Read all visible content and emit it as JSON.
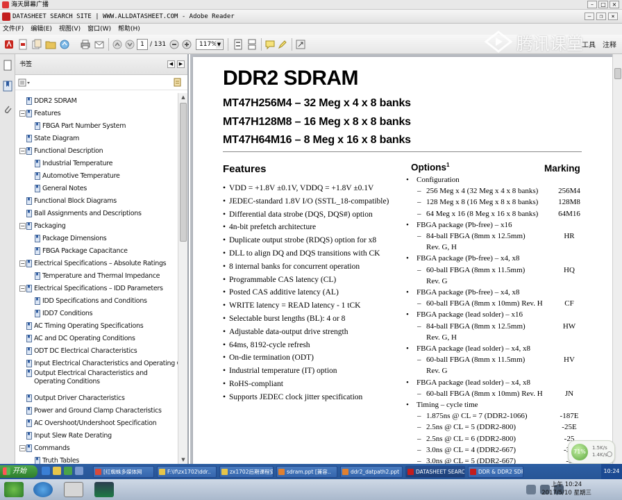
{
  "window": {
    "outer_title": "海天屏幕广播",
    "app_title": "DATASHEET SEARCH SITE | WWW.ALLDATASHEET.COM - Adobe Reader"
  },
  "menu": [
    "文件(F)",
    "编辑(E)",
    "视图(V)",
    "窗口(W)",
    "帮助(H)"
  ],
  "toolbar": {
    "page_current": "1",
    "page_total": "/ 131",
    "zoom": "117%",
    "right_buttons": [
      "工具",
      "注释"
    ],
    "watermark_text": "腾讯课堂"
  },
  "bookmarks": {
    "title": "书签",
    "items": [
      {
        "label": "DDR2 SDRAM",
        "level": 0,
        "expandable": false
      },
      {
        "label": "Features",
        "level": 0,
        "expandable": true
      },
      {
        "label": "FBGA Part Number System",
        "level": 1,
        "expandable": false
      },
      {
        "label": "State Diagram",
        "level": 0,
        "expandable": false
      },
      {
        "label": "Functional Description",
        "level": 0,
        "expandable": true
      },
      {
        "label": "Industrial Temperature",
        "level": 1,
        "expandable": false
      },
      {
        "label": "Automotive Temperature",
        "level": 1,
        "expandable": false
      },
      {
        "label": "General Notes",
        "level": 1,
        "expandable": false
      },
      {
        "label": "Functional Block Diagrams",
        "level": 0,
        "expandable": false
      },
      {
        "label": "Ball Assignments and Descriptions",
        "level": 0,
        "expandable": false
      },
      {
        "label": "Packaging",
        "level": 0,
        "expandable": true
      },
      {
        "label": "Package Dimensions",
        "level": 1,
        "expandable": false
      },
      {
        "label": "FBGA Package Capacitance",
        "level": 1,
        "expandable": false
      },
      {
        "label": "Electrical Specifications – Absolute Ratings",
        "level": 0,
        "expandable": true
      },
      {
        "label": "Temperature and Thermal Impedance",
        "level": 1,
        "expandable": false
      },
      {
        "label": "Electrical Specifications – IDD Parameters",
        "level": 0,
        "expandable": true
      },
      {
        "label": "IDD Specifications and Conditions",
        "level": 1,
        "expandable": false
      },
      {
        "label": "IDD7 Conditions",
        "level": 1,
        "expandable": false
      },
      {
        "label": "AC Timing Operating Specifications",
        "level": 0,
        "expandable": false
      },
      {
        "label": "AC and DC Operating Conditions",
        "level": 0,
        "expandable": false
      },
      {
        "label": "ODT DC Electrical Characteristics",
        "level": 0,
        "expandable": false
      },
      {
        "label": "Input Electrical Characteristics and Operating Conditions",
        "level": 0,
        "expandable": false
      },
      {
        "label": "Output Electrical Characteristics and Operating Conditions",
        "level": 0,
        "expandable": false
      },
      {
        "label": "Output Driver Characteristics",
        "level": 0,
        "expandable": false
      },
      {
        "label": "Power and Ground Clamp Characteristics",
        "level": 0,
        "expandable": false
      },
      {
        "label": "AC Overshoot/Undershoot Specification",
        "level": 0,
        "expandable": false
      },
      {
        "label": "Input Slew Rate Derating",
        "level": 0,
        "expandable": false
      },
      {
        "label": "Commands",
        "level": 0,
        "expandable": true
      },
      {
        "label": "Truth Tables",
        "level": 1,
        "expandable": false
      }
    ]
  },
  "document": {
    "title": "DDR2 SDRAM",
    "parts": [
      "MT47H256M4 – 32 Meg x 4 x 8 banks",
      "MT47H128M8 – 16 Meg x 8 x 8 banks",
      "MT47H64M16 – 8 Meg x 16 x 8 banks"
    ],
    "features_heading": "Features",
    "features": [
      "VDD = +1.8V ±0.1V, VDDQ = +1.8V ±0.1V",
      "JEDEC-standard 1.8V I/O (SSTL_18-compatible)",
      "Differential data strobe (DQS, DQS#) option",
      "4n-bit prefetch architecture",
      "Duplicate output strobe (RDQS) option for x8",
      "DLL to align DQ and DQS transitions with CK",
      "8 internal banks for concurrent operation",
      "Programmable CAS latency (CL)",
      "Posted CAS additive latency (AL)",
      "WRITE latency = READ latency - 1 tCK",
      "Selectable burst lengths (BL): 4 or 8",
      "Adjustable data-output drive strength",
      "64ms, 8192-cycle refresh",
      "On-die termination (ODT)",
      "Industrial temperature (IT) option",
      "RoHS-compliant",
      "Supports JEDEC clock jitter specification"
    ],
    "options_heading": "Options",
    "options_sup": "1",
    "marking_heading": "Marking",
    "options": [
      {
        "text": "Configuration",
        "level": 1,
        "mark": ""
      },
      {
        "text": "256 Meg x 4 (32 Meg x 4 x 8 banks)",
        "level": 2,
        "mark": "256M4"
      },
      {
        "text": "128 Meg x 8 (16 Meg x 8 x 8 banks)",
        "level": 2,
        "mark": "128M8"
      },
      {
        "text": "64 Meg x 16 (8 Meg x 16 x 8 banks)",
        "level": 2,
        "mark": "64M16"
      },
      {
        "text": "FBGA package (Pb-free) – x16",
        "level": 1,
        "mark": ""
      },
      {
        "text": "84-ball FBGA (8mm x 12.5mm)",
        "level": 2,
        "mark": "HR"
      },
      {
        "text": "Rev. G, H",
        "level": 3,
        "mark": ""
      },
      {
        "text": "FBGA package (Pb-free) – x4, x8",
        "level": 1,
        "mark": ""
      },
      {
        "text": "60-ball FBGA (8mm x 11.5mm)",
        "level": 2,
        "mark": "HQ"
      },
      {
        "text": "Rev. G",
        "level": 3,
        "mark": ""
      },
      {
        "text": "FBGA package (Pb-free) – x4, x8",
        "level": 1,
        "mark": ""
      },
      {
        "text": "60-ball FBGA (8mm x 10mm) Rev. H",
        "level": 2,
        "mark": "CF"
      },
      {
        "text": "FBGA package (lead solder) – x16",
        "level": 1,
        "mark": ""
      },
      {
        "text": "84-ball FBGA (8mm x 12.5mm)",
        "level": 2,
        "mark": "HW"
      },
      {
        "text": "Rev. G, H",
        "level": 3,
        "mark": ""
      },
      {
        "text": "FBGA package (lead solder) – x4, x8",
        "level": 1,
        "mark": ""
      },
      {
        "text": "60-ball FBGA (8mm x 11.5mm)",
        "level": 2,
        "mark": "HV"
      },
      {
        "text": "Rev. G",
        "level": 3,
        "mark": ""
      },
      {
        "text": "FBGA package (lead solder) – x4, x8",
        "level": 1,
        "mark": ""
      },
      {
        "text": "60-ball FBGA (8mm x 10mm) Rev. H",
        "level": 2,
        "mark": "JN"
      },
      {
        "text": "Timing – cycle time",
        "level": 1,
        "mark": ""
      },
      {
        "text": "1.875ns @ CL = 7 (DDR2-1066)",
        "level": 2,
        "mark": "-187E"
      },
      {
        "text": "2.5ns @ CL = 5 (DDR2-800)",
        "level": 2,
        "mark": "-25E"
      },
      {
        "text": "2.5ns @ CL = 6 (DDR2-800)",
        "level": 2,
        "mark": "-25"
      },
      {
        "text": "3.0ns @ CL = 4 (DDR2-667)",
        "level": 2,
        "mark": "-3E"
      },
      {
        "text": "3.0ns @ CL = 5 (DDR2-667)",
        "level": 2,
        "mark": "-3"
      }
    ]
  },
  "taskbar": {
    "start_label": "开始",
    "tasks": [
      "[红蜘蛛多媒体网",
      "F:\\lf\\zx1702\\ddr..",
      "zx1702后期课程安..",
      "sdram.ppt [兼容..",
      "ddr2_datpath2.ppt",
      "DATASHEET SEARCH..",
      "DDR & DDR2 SDRAM.."
    ],
    "clock_top": "10:24",
    "clock_time": "上午 10:24",
    "clock_date": "2017/5/10 星期三"
  },
  "widget": {
    "percent": "71%",
    "line1": "1.5K/s",
    "line2": "1.4K/s"
  },
  "colors": {
    "pdf_red": "#c31d1d",
    "taskbar_blue": "#2d5fa3",
    "doc_background": "#b9bcc3"
  }
}
